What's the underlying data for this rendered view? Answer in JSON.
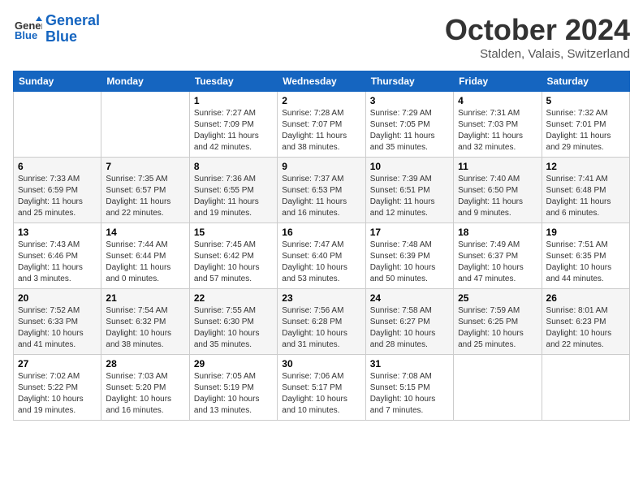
{
  "header": {
    "logo_line1": "General",
    "logo_line2": "Blue",
    "month": "October 2024",
    "location": "Stalden, Valais, Switzerland"
  },
  "days_of_week": [
    "Sunday",
    "Monday",
    "Tuesday",
    "Wednesday",
    "Thursday",
    "Friday",
    "Saturday"
  ],
  "weeks": [
    [
      {
        "num": "",
        "info": ""
      },
      {
        "num": "",
        "info": ""
      },
      {
        "num": "1",
        "info": "Sunrise: 7:27 AM\nSunset: 7:09 PM\nDaylight: 11 hours and 42 minutes."
      },
      {
        "num": "2",
        "info": "Sunrise: 7:28 AM\nSunset: 7:07 PM\nDaylight: 11 hours and 38 minutes."
      },
      {
        "num": "3",
        "info": "Sunrise: 7:29 AM\nSunset: 7:05 PM\nDaylight: 11 hours and 35 minutes."
      },
      {
        "num": "4",
        "info": "Sunrise: 7:31 AM\nSunset: 7:03 PM\nDaylight: 11 hours and 32 minutes."
      },
      {
        "num": "5",
        "info": "Sunrise: 7:32 AM\nSunset: 7:01 PM\nDaylight: 11 hours and 29 minutes."
      }
    ],
    [
      {
        "num": "6",
        "info": "Sunrise: 7:33 AM\nSunset: 6:59 PM\nDaylight: 11 hours and 25 minutes."
      },
      {
        "num": "7",
        "info": "Sunrise: 7:35 AM\nSunset: 6:57 PM\nDaylight: 11 hours and 22 minutes."
      },
      {
        "num": "8",
        "info": "Sunrise: 7:36 AM\nSunset: 6:55 PM\nDaylight: 11 hours and 19 minutes."
      },
      {
        "num": "9",
        "info": "Sunrise: 7:37 AM\nSunset: 6:53 PM\nDaylight: 11 hours and 16 minutes."
      },
      {
        "num": "10",
        "info": "Sunrise: 7:39 AM\nSunset: 6:51 PM\nDaylight: 11 hours and 12 minutes."
      },
      {
        "num": "11",
        "info": "Sunrise: 7:40 AM\nSunset: 6:50 PM\nDaylight: 11 hours and 9 minutes."
      },
      {
        "num": "12",
        "info": "Sunrise: 7:41 AM\nSunset: 6:48 PM\nDaylight: 11 hours and 6 minutes."
      }
    ],
    [
      {
        "num": "13",
        "info": "Sunrise: 7:43 AM\nSunset: 6:46 PM\nDaylight: 11 hours and 3 minutes."
      },
      {
        "num": "14",
        "info": "Sunrise: 7:44 AM\nSunset: 6:44 PM\nDaylight: 11 hours and 0 minutes."
      },
      {
        "num": "15",
        "info": "Sunrise: 7:45 AM\nSunset: 6:42 PM\nDaylight: 10 hours and 57 minutes."
      },
      {
        "num": "16",
        "info": "Sunrise: 7:47 AM\nSunset: 6:40 PM\nDaylight: 10 hours and 53 minutes."
      },
      {
        "num": "17",
        "info": "Sunrise: 7:48 AM\nSunset: 6:39 PM\nDaylight: 10 hours and 50 minutes."
      },
      {
        "num": "18",
        "info": "Sunrise: 7:49 AM\nSunset: 6:37 PM\nDaylight: 10 hours and 47 minutes."
      },
      {
        "num": "19",
        "info": "Sunrise: 7:51 AM\nSunset: 6:35 PM\nDaylight: 10 hours and 44 minutes."
      }
    ],
    [
      {
        "num": "20",
        "info": "Sunrise: 7:52 AM\nSunset: 6:33 PM\nDaylight: 10 hours and 41 minutes."
      },
      {
        "num": "21",
        "info": "Sunrise: 7:54 AM\nSunset: 6:32 PM\nDaylight: 10 hours and 38 minutes."
      },
      {
        "num": "22",
        "info": "Sunrise: 7:55 AM\nSunset: 6:30 PM\nDaylight: 10 hours and 35 minutes."
      },
      {
        "num": "23",
        "info": "Sunrise: 7:56 AM\nSunset: 6:28 PM\nDaylight: 10 hours and 31 minutes."
      },
      {
        "num": "24",
        "info": "Sunrise: 7:58 AM\nSunset: 6:27 PM\nDaylight: 10 hours and 28 minutes."
      },
      {
        "num": "25",
        "info": "Sunrise: 7:59 AM\nSunset: 6:25 PM\nDaylight: 10 hours and 25 minutes."
      },
      {
        "num": "26",
        "info": "Sunrise: 8:01 AM\nSunset: 6:23 PM\nDaylight: 10 hours and 22 minutes."
      }
    ],
    [
      {
        "num": "27",
        "info": "Sunrise: 7:02 AM\nSunset: 5:22 PM\nDaylight: 10 hours and 19 minutes."
      },
      {
        "num": "28",
        "info": "Sunrise: 7:03 AM\nSunset: 5:20 PM\nDaylight: 10 hours and 16 minutes."
      },
      {
        "num": "29",
        "info": "Sunrise: 7:05 AM\nSunset: 5:19 PM\nDaylight: 10 hours and 13 minutes."
      },
      {
        "num": "30",
        "info": "Sunrise: 7:06 AM\nSunset: 5:17 PM\nDaylight: 10 hours and 10 minutes."
      },
      {
        "num": "31",
        "info": "Sunrise: 7:08 AM\nSunset: 5:15 PM\nDaylight: 10 hours and 7 minutes."
      },
      {
        "num": "",
        "info": ""
      },
      {
        "num": "",
        "info": ""
      }
    ]
  ]
}
